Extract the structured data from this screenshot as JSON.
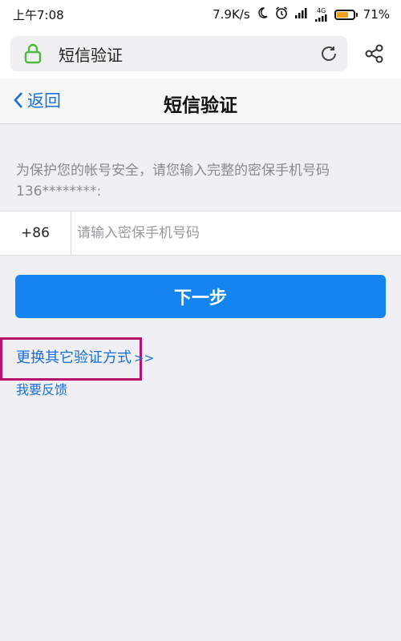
{
  "statusbar": {
    "time": "上午7:08",
    "net_speed": "7.9K/s",
    "network_type": "4G",
    "battery": "71%",
    "battery_level": 0.71,
    "icons": [
      "moon-icon",
      "alarm-icon",
      "signal-icon",
      "signal-4g-icon",
      "battery-icon"
    ]
  },
  "browser": {
    "url_title": "短信验证",
    "icons": [
      "lock-icon",
      "reload-icon",
      "share-icon"
    ],
    "lock_color": "#4cbb3c"
  },
  "nav": {
    "back_label": "返回",
    "title": "短信验证"
  },
  "form": {
    "prompt": "为保护您的帐号安全，请您输入完整的密保手机号码136********:",
    "country_code": "+86",
    "phone_placeholder": "请输入密保手机号码",
    "phone_value": "",
    "next_label": "下一步"
  },
  "links": {
    "switch_method": "更换其它验证方式",
    "switch_arrows": ">>",
    "feedback": "我要反馈"
  },
  "colors": {
    "accent": "#1484f0",
    "link": "#1a6fd8",
    "highlight": "#b8126e",
    "background": "#efeff4"
  }
}
